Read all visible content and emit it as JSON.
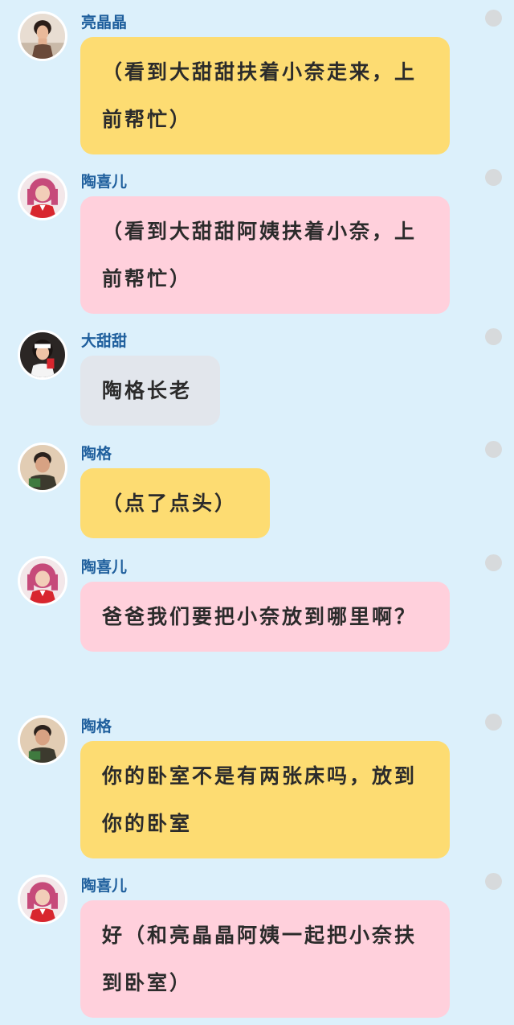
{
  "messages": [
    {
      "speaker": "亮晶晶",
      "text": "（看到大甜甜扶着小奈走来，上前帮忙）",
      "bubble_color": "yellow",
      "avatar": "liangjingjing-avatar"
    },
    {
      "speaker": "陶喜儿",
      "text": "（看到大甜甜阿姨扶着小奈，上前帮忙）",
      "bubble_color": "pink",
      "avatar": "taoxier-avatar"
    },
    {
      "speaker": "大甜甜",
      "text": "陶格长老",
      "bubble_color": "grey",
      "avatar": "datiantian-avatar"
    },
    {
      "speaker": "陶格",
      "text": "（点了点头）",
      "bubble_color": "yellow",
      "avatar": "taoge-avatar"
    },
    {
      "speaker": "陶喜儿",
      "text": "爸爸我们要把小奈放到哪里啊？",
      "bubble_color": "pink",
      "avatar": "taoxier-avatar"
    },
    {
      "speaker": "陶格",
      "text": "你的卧室不是有两张床吗，放到你的卧室",
      "bubble_color": "yellow",
      "avatar": "taoge-avatar"
    },
    {
      "speaker": "陶喜儿",
      "text": "好（和亮晶晶阿姨一起把小奈扶到卧室）",
      "bubble_color": "pink",
      "avatar": "taoxier-avatar"
    }
  ],
  "colors": {
    "background": "#dcf0fb",
    "speaker_name": "#1f5f9d",
    "bubble_yellow": "#fddc72",
    "bubble_pink": "#ffd0dc",
    "bubble_grey": "#e2e6ec",
    "menu_dot": "#d7dadc"
  }
}
